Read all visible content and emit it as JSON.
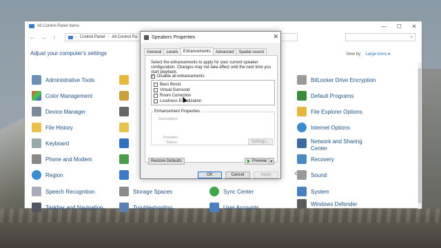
{
  "control_panel": {
    "title": "All Control Panel Items",
    "breadcrumbs": [
      "Control Panel",
      "All Control Pa"
    ],
    "heading": "Adjust your computer's settings",
    "view_by_label": "View by:",
    "view_by_value": "Large icons ▾",
    "left_items": [
      "Administrative Tools",
      "Color Management",
      "Device Manager",
      "File History",
      "Keyboard",
      "Phone and Modem",
      "Region",
      "Speech Recognition",
      "Taskbar and Navigation"
    ],
    "middle_items_partial": [
      "Storage Spaces",
      "Troubleshooting"
    ],
    "middle2_items": [
      "Sync Center",
      "User Accounts"
    ],
    "right_items": [
      "BitLocker Drive Encryption",
      "Default Programs",
      "File Explorer Options",
      "Internet Options",
      "Network and Sharing Center",
      "Recovery",
      "Sound",
      "System",
      "Windows Defender"
    ]
  },
  "dialog": {
    "title": "Speakers Properties",
    "close": "✕",
    "tabs": [
      "General",
      "Levels",
      "Enhancements",
      "Advanced",
      "Spatial sound"
    ],
    "description": "Select the enhancements to apply for your current speaker configuration. Changes may not take effect until the next time you start playback.",
    "disable_all_label": "Disable all enhancements",
    "disable_all_checked": true,
    "enhancements": [
      {
        "label": "Bass Boost",
        "checked": false
      },
      {
        "label": "Virtual Surround",
        "checked": false
      },
      {
        "label": "Room Correction",
        "checked": false
      },
      {
        "label": "Loudness Equalization",
        "checked": false
      }
    ],
    "properties_legend": "Enhancement Properties",
    "description_label": "Description:",
    "provider_label": "Provider:",
    "status_label": "Status:",
    "settings_btn": "Settings...",
    "restore_btn": "Restore Defaults",
    "preview_btn": "Preview",
    "ok_btn": "OK",
    "cancel_btn": "Cancel",
    "apply_btn": "Apply"
  },
  "colors": {
    "link": "#1a4f8b",
    "accent": "#1a73d6"
  }
}
